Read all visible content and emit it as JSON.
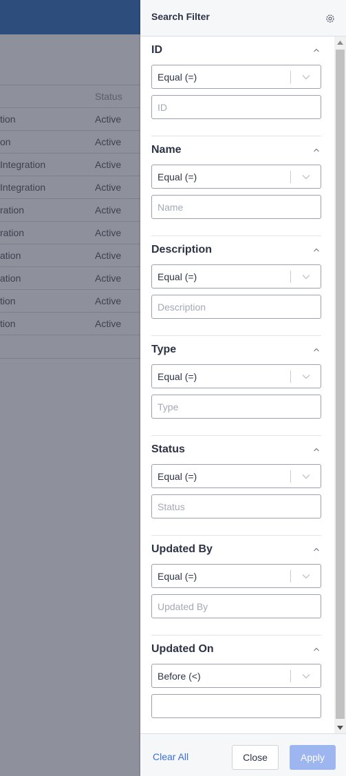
{
  "background": {
    "table": {
      "header": {
        "col1": "",
        "col2": "Status"
      },
      "rows": [
        {
          "name": "tion",
          "status": "Active"
        },
        {
          "name": "on",
          "status": "Active"
        },
        {
          "name": " Integration",
          "status": "Active"
        },
        {
          "name": " Integration",
          "status": "Active"
        },
        {
          "name": "ration",
          "status": "Active"
        },
        {
          "name": "ration",
          "status": "Active"
        },
        {
          "name": "ation",
          "status": "Active"
        },
        {
          "name": "ation",
          "status": "Active"
        },
        {
          "name": "tion",
          "status": "Active"
        },
        {
          "name": "tion",
          "status": "Active"
        }
      ]
    }
  },
  "panel": {
    "title": "Search Filter",
    "settings_icon": "gear-icon",
    "sections": [
      {
        "label": "ID",
        "operator": "Equal (=)",
        "placeholder": "ID",
        "value": ""
      },
      {
        "label": "Name",
        "operator": "Equal (=)",
        "placeholder": "Name",
        "value": ""
      },
      {
        "label": "Description",
        "operator": "Equal (=)",
        "placeholder": "Description",
        "value": ""
      },
      {
        "label": "Type",
        "operator": "Equal (=)",
        "placeholder": "Type",
        "value": ""
      },
      {
        "label": "Status",
        "operator": "Equal (=)",
        "placeholder": "Status",
        "value": ""
      },
      {
        "label": "Updated By",
        "operator": "Equal (=)",
        "placeholder": "Updated By",
        "value": ""
      },
      {
        "label": "Updated On",
        "operator": "Before (<)",
        "placeholder": "",
        "value": ""
      }
    ],
    "footer": {
      "clear_all": "Clear All",
      "close": "Close",
      "apply": "Apply"
    }
  },
  "colors": {
    "header_bg": "#2d4e7c",
    "overlay": "#8e909b",
    "link": "#3a6fd8",
    "apply_disabled": "#9db6ef"
  }
}
